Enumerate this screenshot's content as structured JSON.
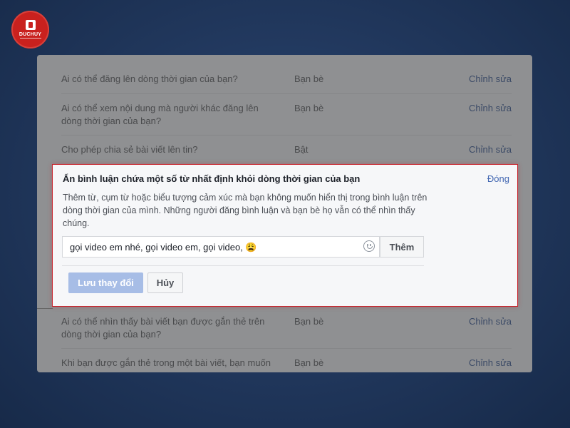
{
  "logo": {
    "text": "DUCHUY"
  },
  "settings_rows": [
    {
      "question": "Ai có thể đăng lên dòng thời gian của bạn?",
      "value": "Bạn bè",
      "edit": "Chỉnh sửa"
    },
    {
      "question": "Ai có thể xem nội dung mà người khác đăng lên dòng thời gian của bạn?",
      "value": "Bạn bè",
      "edit": "Chỉnh sửa"
    },
    {
      "question": "Cho phép chia sẻ bài viết lên tin?",
      "value": "Bật",
      "edit": "Chỉnh sửa"
    },
    {
      "question": "Ai có thể nhìn thấy bài viết bạn được gắn thẻ trên dòng thời gian của bạn?",
      "value": "Bạn bè",
      "edit": "Chỉnh sửa"
    },
    {
      "question": "Khi bạn được gắn thẻ trong một bài viết, bạn muốn",
      "value": "Bạn bè",
      "edit": "Chỉnh sửa"
    }
  ],
  "dialog": {
    "title": "Ẩn bình luận chứa một số từ nhất định khỏi dòng thời gian của bạn",
    "close": "Đóng",
    "description": "Thêm từ, cụm từ hoặc biểu tượng cảm xúc mà bạn không muốn hiển thị trong bình luận trên dòng thời gian của mình. Những người đăng bình luận và bạn bè họ vẫn có thể nhìn thấy chúng.",
    "input_value": "gọi video em nhé, gọi video em, gọi video, 😩",
    "add_button": "Thêm",
    "save_button": "Lưu thay đổi",
    "cancel_button": "Hủy"
  },
  "colors": {
    "accent": "#4267b2",
    "highlight_border": "#c8232c",
    "logo_red": "#c9211e"
  }
}
